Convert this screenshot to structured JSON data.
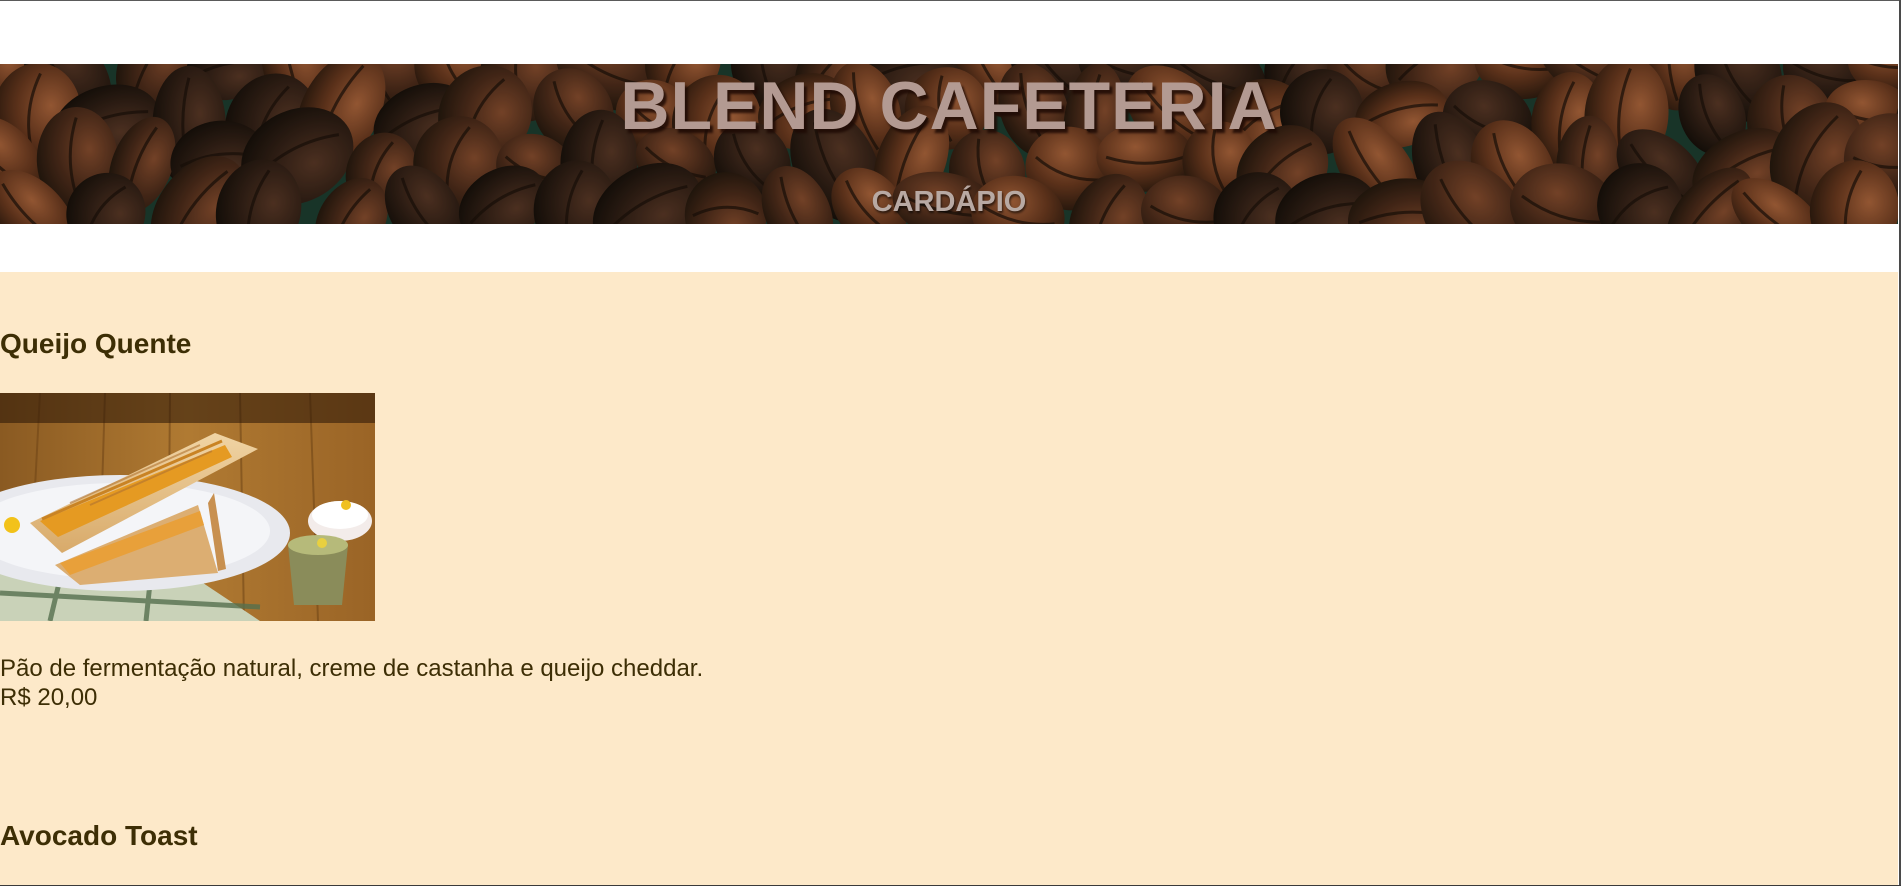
{
  "header": {
    "title": "BLEND CAFETERIA",
    "subtitle": "CARDÁPIO"
  },
  "menu": {
    "items": [
      {
        "name": "Queijo Quente",
        "description": "Pão de fermentação natural, creme de castanha e queijo cheddar.",
        "price": "R$ 20,00"
      },
      {
        "name": "Avocado Toast"
      }
    ]
  },
  "colors": {
    "menu_background": "#fde9c9",
    "text": "#3d2e05",
    "title": "#b39a92",
    "banner_dark": "#1c3a2e"
  }
}
